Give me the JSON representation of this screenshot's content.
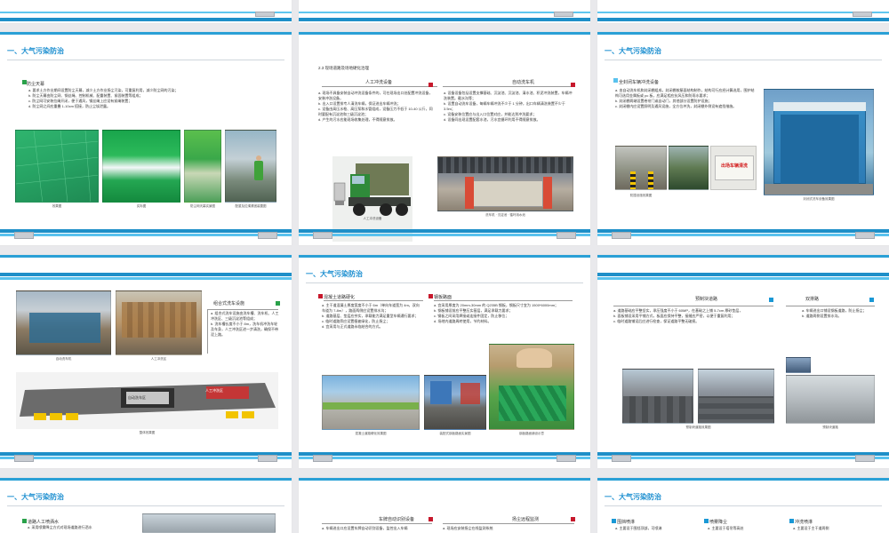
{
  "section_title": "一、大气污染防治",
  "s2": {
    "title": "防尘天幕",
    "lines": [
      "a. 要求土方作业期间设置防尘天幕，减少土方作业扬尘污染，可重复利用，减少防尘网的污染；",
      "b. 防尘天幕由防尘网、钢丝绳、控制机械、配重装置、紧固装置等组成；",
      "c. 防尘网可安装拉绳开闭，便于通风，钢丝绳上应设有紧绳装置；",
      "d. 防尘网之间应重叠 1-10cm 搭接，防止尘埃泄露。"
    ],
    "caps": [
      "效果图",
      "实际图",
      "防尘网天幕实景图",
      "配重及拉绳紧固装置图"
    ]
  },
  "s3": {
    "title": "2.3 现场道路及场地硬化治理",
    "left_heading": "人工冲洗设备",
    "left_lines": [
      "a. 现场不具备安装自动冲洗设备条件的，可在现场出口处配置冲洗设备，安装冲洗设备，",
      "b. 出入口设置排专人清洗车辆，保证进出车辆冲洗；",
      "c. 设备由高压水枪、高压泵和水管组成，设备压力不低于 10-40 公斤，同时要配有沉淀池和三级沉淀池；",
      "d. 产生的污水应能现场收集处理，不得随意排放。"
    ],
    "left_cap": "人工冲洗设备",
    "right_heading": "自动洗车机",
    "right_lines": [
      "a. 设备设备包括设置支撑基础、沉淀池、沉淀池、清水池、积泥冲洗装置，车辆冲洗装置。截水沟等；",
      "b. 设置自动洗车设备，每辆车辆冲洗不少于 1 分钟，出口车辆清洗装置不少于 3.5m；",
      "c. 设备安装位置应与出入口位置对应，并能达到冲洗要求；",
      "d. 设备同出现设置配套水池，污水宜循环利用不得随意排放。"
    ],
    "right_cap": "洗车机 · 沉淀池 · 循环用水池"
  },
  "s4": {
    "title": "全封闭车辆冲洗设备",
    "lines": [
      "a. 由自动洗车机和封闭棚组成，封闭棚按屋面结构制作，结构可行应经计算选用，围护结构可选用金属板或 pc 板，应满足相应抗风压和防雨水要求；",
      "b. 封闭棚两端设置卷帘门或自动门，其他部分设置防护设施；",
      "c. 封闭棚内应设置照明及通风设施，全方位冲洗，封闭棚外侧设有遮挡措施。"
    ],
    "caps": [
      "防撞设施效果图",
      "封闭式洗车设备效果图"
    ],
    "sign_text": "出场车辆清洗"
  },
  "s5": {
    "heading": "组合式洗车设施",
    "lines": [
      "a. 组合式洗车设施由洗车槽、洗车机、人工冲洗区、三级沉淀池等组成；",
      "b. 洗车槽长度不小于 8m，洗车机冲洗车轮及车身，人工冲洗区进一步清洗，确保不带泥上路。"
    ],
    "caps": [
      "自动洗车机",
      "人工冲洗区",
      "整体效果图"
    ],
    "labels": [
      "人工冲洗区",
      "自动洗车区"
    ]
  },
  "s6": {
    "left_heading": "混凝土道路硬化",
    "left_lines": [
      "a. 主干道混凝土厚度宽度不小于 6m（单向车道宽为 4m，双向车道为 7-8m），路面两侧应设置排水沟；",
      "b. 道路基层、垫层应夯实，承载能力满足重型车辆通行要求；",
      "c. 临时道路旁应设置植被绿化，防止扬尘；",
      "d. 宜采用与正式道路永临结合的方式。"
    ],
    "right_heading": "钢板路面",
    "right_lines": [
      "a. 宜采用厚度为 20mm-30mm 的 Q235B 钢板，钢板尺寸宜为 1500*6000mm；",
      "b. 钢板铺设前应平整压实基层，满足承载力要求；",
      "c. 钢板之间采用焊接或连接件固定，防止移位；",
      "d. 场地内道路周转使用，节约材料。"
    ],
    "caps": [
      "混凝土道路硬化效果图",
      "装配式钢板路面实景图",
      "钢板路面铺设示意"
    ]
  },
  "s7": {
    "left_heading": "预制块道路",
    "left_lines": [
      "a. 道路基础应平整坚实，承压强度不小于 60MP，在基础之上铺 5-7cm 厚砂垫层，",
      "b. 面板铺设采用平铺方式，板面应保持平整，接缝应严密，以便于重复利用；",
      "c. 临时道路铺设后应进行检查，保证道路平整无破损。"
    ],
    "left_cap": "预制块道路效果图",
    "right_heading": "双排路",
    "right_lines": [
      "a. 车辆进出口铺设钢板道路，防止扬尘；",
      "b. 道路两侧设置排水沟。"
    ],
    "right_cap": "预制块道路"
  },
  "s8": {
    "heading": "道路人工喷洒水",
    "line": "a. 采用喷雾降尘方式对现场道路进行洒水"
  },
  "s9": {
    "left_heading": "车牌自动识别设备",
    "left_line": "a. 车辆进出口应设置车牌自动识别设备，监控出入车辆",
    "right_heading": "扬尘远程监测",
    "right_line": "a. 现场应安装扬尘在线监测系统"
  },
  "s10": {
    "h1": "围挡喷淋",
    "h2": "喷雾降尘",
    "h3": "冲洗喷淋",
    "l1": "a. 主要设于围挡顶部，可喷淋",
    "l2": "a. 主要设于塔吊等高处",
    "l3": "a. 主要设于主干道两侧"
  }
}
